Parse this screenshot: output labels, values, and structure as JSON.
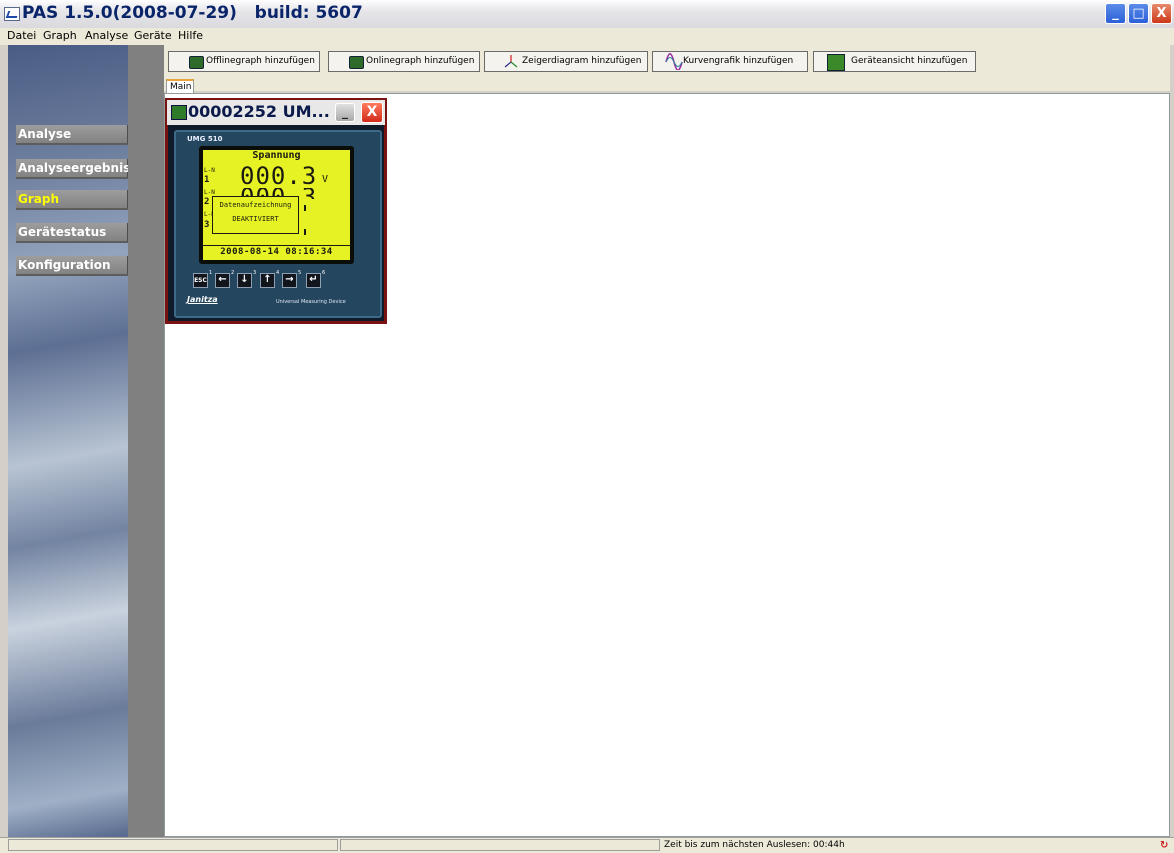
{
  "window": {
    "title": "PAS 1.5.0(2008-07-29)   build: 5607",
    "minimize": "_",
    "maximize": "□",
    "close": "X"
  },
  "menu": [
    "Datei",
    "Graph",
    "Analyse",
    "Geräte",
    "Hilfe"
  ],
  "sidebar": {
    "items": [
      {
        "label": "Analyse",
        "active": false
      },
      {
        "label": "Analyseergebnis",
        "active": false
      },
      {
        "label": "Graph",
        "active": true
      },
      {
        "label": "Gerätestatus",
        "active": false
      },
      {
        "label": "Konfiguration",
        "active": false
      }
    ],
    "active_color": "#ffff00"
  },
  "toolbar": [
    {
      "label": "Offlinegraph hinzufügen",
      "icon": "monitor-icon"
    },
    {
      "label": "Onlinegraph hinzufügen",
      "icon": "monitor-icon"
    },
    {
      "label": "Zeigerdiagram hinzufügen",
      "icon": "phasor-icon"
    },
    {
      "label": "Kurvengrafik hinzufügen",
      "icon": "waveform-icon"
    },
    {
      "label": "Geräteansicht hinzufügen",
      "icon": "device-icon"
    }
  ],
  "tabs": [
    {
      "label": "Main",
      "active": true
    }
  ],
  "device_window": {
    "title": "00002252 UM...",
    "minimize": "_",
    "close": "X",
    "device": {
      "model": "UMG 510",
      "lcd_title": "Spannung",
      "line_labels": [
        "L-N",
        "L-N",
        "L-N"
      ],
      "line_numbers": [
        "1",
        "2",
        "3"
      ],
      "value_1": "000.3",
      "unit": "V",
      "value_2": "000.3",
      "popup_line1": "Datenaufzeichnung",
      "popup_line2": "DEAKTIVIERT",
      "datetime": "2008-08-14 08:16:34",
      "keys": [
        {
          "label": "ESC",
          "num": "1"
        },
        {
          "label": "←",
          "num": "2"
        },
        {
          "label": "↓",
          "num": "3"
        },
        {
          "label": "↑",
          "num": "4"
        },
        {
          "label": "→",
          "num": "5"
        },
        {
          "label": "↵",
          "num": "6"
        }
      ],
      "brand": "Janitza",
      "tagline": "Universal Measuring Device",
      "lcd_color": "#e6f223"
    }
  },
  "statusbar": {
    "text": "Zeit bis zum nächsten Auslesen: 00:44h",
    "icon": "sync-icon"
  }
}
